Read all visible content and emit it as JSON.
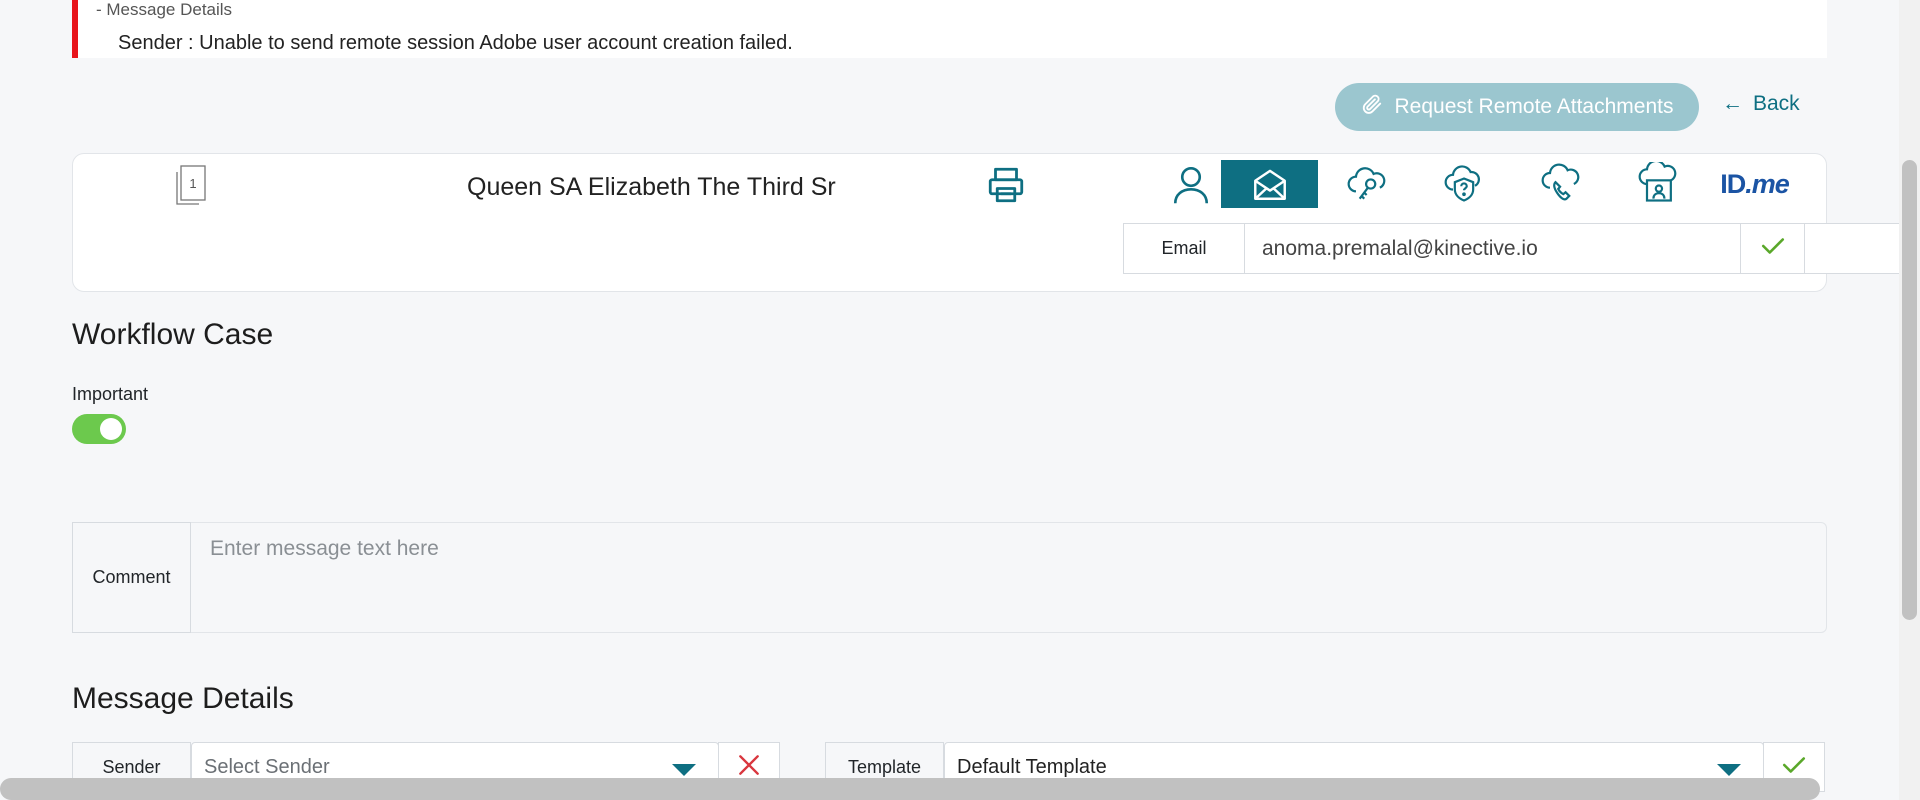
{
  "error_banner": {
    "title": "- Message Details",
    "message": "Sender :  Unable to send remote session Adobe user account creation failed."
  },
  "actions": {
    "request_attachments": "Request Remote Attachments",
    "back": "Back",
    "back_arrow": "←"
  },
  "customer": {
    "page_count": "1",
    "name": "Queen SA Elizabeth The Third Sr",
    "channels": [
      {
        "icon": "person-icon"
      },
      {
        "icon": "email-icon",
        "active": true
      },
      {
        "icon": "cloud-key-icon"
      },
      {
        "icon": "cloud-shield-question-icon"
      },
      {
        "icon": "cloud-phone-icon"
      },
      {
        "icon": "cloud-id-card-icon"
      },
      {
        "icon": "idme-logo",
        "text_id": "ID",
        "text_me": ".me"
      }
    ],
    "email_label": "Email",
    "email_value": "anoma.premalal@kinective.io"
  },
  "workflow": {
    "title": "Workflow Case",
    "important_label": "Important",
    "important_on": true,
    "comment_label": "Comment",
    "comment_placeholder": "Enter message text here"
  },
  "message_details": {
    "title": "Message Details",
    "sender_label": "Sender",
    "sender_placeholder": "Select Sender",
    "template_label": "Template",
    "template_value": "Default Template"
  },
  "colors": {
    "accent": "#0e6f82",
    "error": "#e8141b",
    "success": "#6cc94d",
    "button_disabled": "#9bc6cf"
  }
}
